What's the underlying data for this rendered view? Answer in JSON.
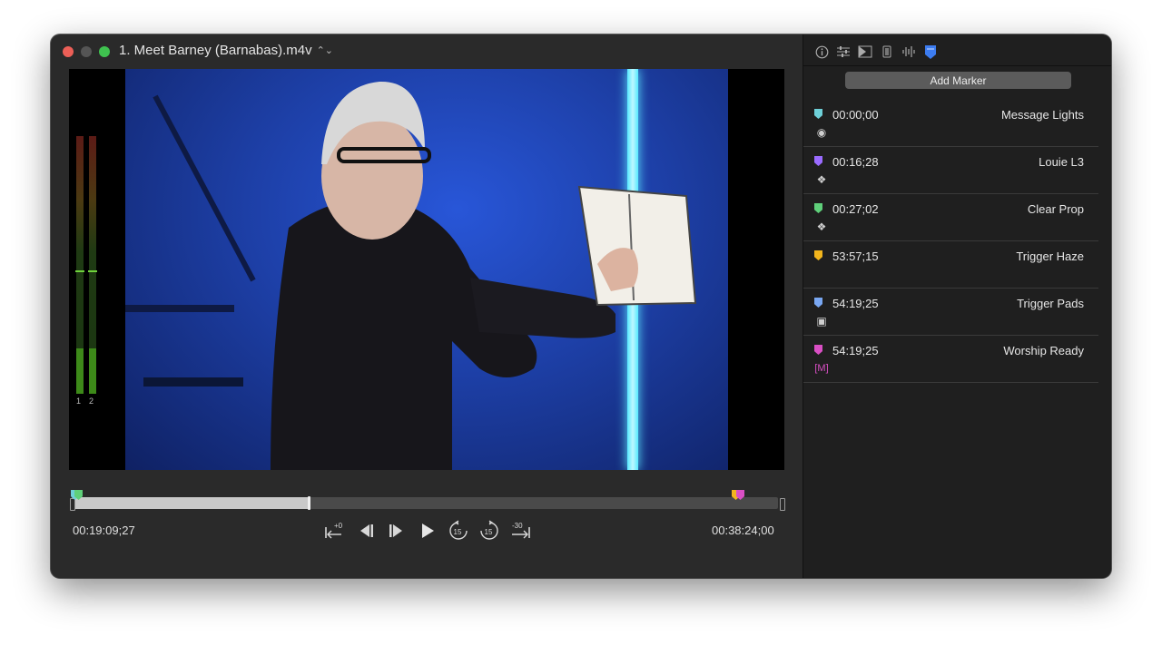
{
  "window": {
    "title": "1. Meet Barney (Barnabas).m4v",
    "title_chevron": "⌃⌄"
  },
  "meters": {
    "labels": [
      "1",
      "2"
    ]
  },
  "playback": {
    "current_time": "00:19:09;27",
    "duration": "00:38:24;00",
    "progress_fraction": 0.335,
    "controls": {
      "nudge_forward_label": "+0",
      "skip_back_label": "15",
      "skip_forward_label": "15",
      "nudge_back_label": "-30"
    }
  },
  "panel": {
    "toolbar_icons": [
      "info-icon",
      "sliders-icon",
      "transition-icon",
      "display-icon",
      "audio-waveform-icon",
      "marker-icon"
    ],
    "add_marker_label": "Add Marker",
    "markers": [
      {
        "time": "00:00;00",
        "name": "Message Lights",
        "color": "#6ed0d8",
        "action_icon": "lighting-icon",
        "action_glyph": "◉"
      },
      {
        "time": "00:16;28",
        "name": "Louie L3",
        "color": "#9a6bff",
        "action_icon": "layers-icon",
        "action_glyph": "❖"
      },
      {
        "time": "00:27;02",
        "name": "Clear Prop",
        "color": "#5fd07a",
        "action_icon": "clear-layers-icon",
        "action_glyph": "❖"
      },
      {
        "time": "53:57;15",
        "name": "Trigger Haze",
        "color": "#f2b51d",
        "action_icon": "",
        "action_glyph": ""
      },
      {
        "time": "54:19;25",
        "name": "Trigger Pads",
        "color": "#79a7f2",
        "action_icon": "audio-trigger-icon",
        "action_glyph": "▣"
      },
      {
        "time": "54:19;25",
        "name": "Worship Ready",
        "color": "#d94fc4",
        "action_icon": "macro-icon",
        "action_glyph": "[M]"
      }
    ]
  }
}
